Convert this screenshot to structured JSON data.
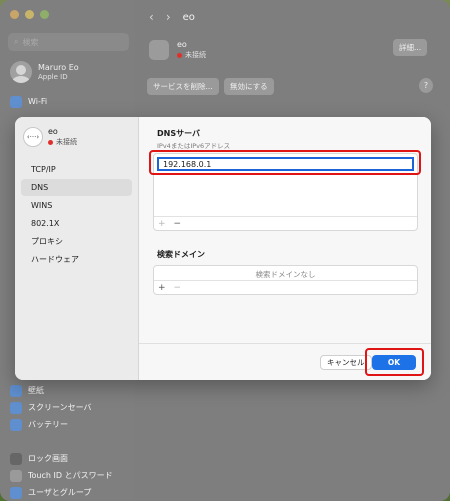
{
  "sidebar": {
    "search_placeholder": "検索",
    "account": {
      "name": "Maruro Eo",
      "sub": "Apple ID"
    },
    "items": [
      {
        "label": "Wi-Fi"
      }
    ],
    "bottom_items": [
      {
        "label": "壁紙"
      },
      {
        "label": "スクリーンセーバ"
      },
      {
        "label": "バッテリー"
      },
      {
        "label": ""
      },
      {
        "label": "ロック画面"
      },
      {
        "label": "Touch ID とパスワード"
      },
      {
        "label": "ユーザとグループ"
      }
    ]
  },
  "header": {
    "back_icon": "‹",
    "forward_icon": "›",
    "title": "eo"
  },
  "service": {
    "name": "eo",
    "status": "未接続",
    "details_button": "詳細...",
    "delete_button": "サービスを削除...",
    "disable_button": "無効にする",
    "help_button": "?"
  },
  "dialog": {
    "service_icon": "‹···›",
    "service_name": "eo",
    "service_status": "未接続",
    "nav": [
      {
        "label": "TCP/IP",
        "active": false
      },
      {
        "label": "DNS",
        "active": true
      },
      {
        "label": "WINS",
        "active": false
      },
      {
        "label": "802.1X",
        "active": false
      },
      {
        "label": "プロキシ",
        "active": false
      },
      {
        "label": "ハードウェア",
        "active": false
      }
    ],
    "dns": {
      "title": "DNSサーバ",
      "subtitle": "IPv4またはIPv6アドレス",
      "value": "192.168.0.1",
      "add": "+",
      "remove": "−"
    },
    "domain": {
      "title": "検索ドメイン",
      "empty": "検索ドメインなし",
      "add": "+",
      "remove": "−"
    },
    "cancel_button": "キャンセル",
    "ok_button": "OK"
  },
  "colors": {
    "highlight": "#e01414",
    "accent": "#1d72e8"
  }
}
